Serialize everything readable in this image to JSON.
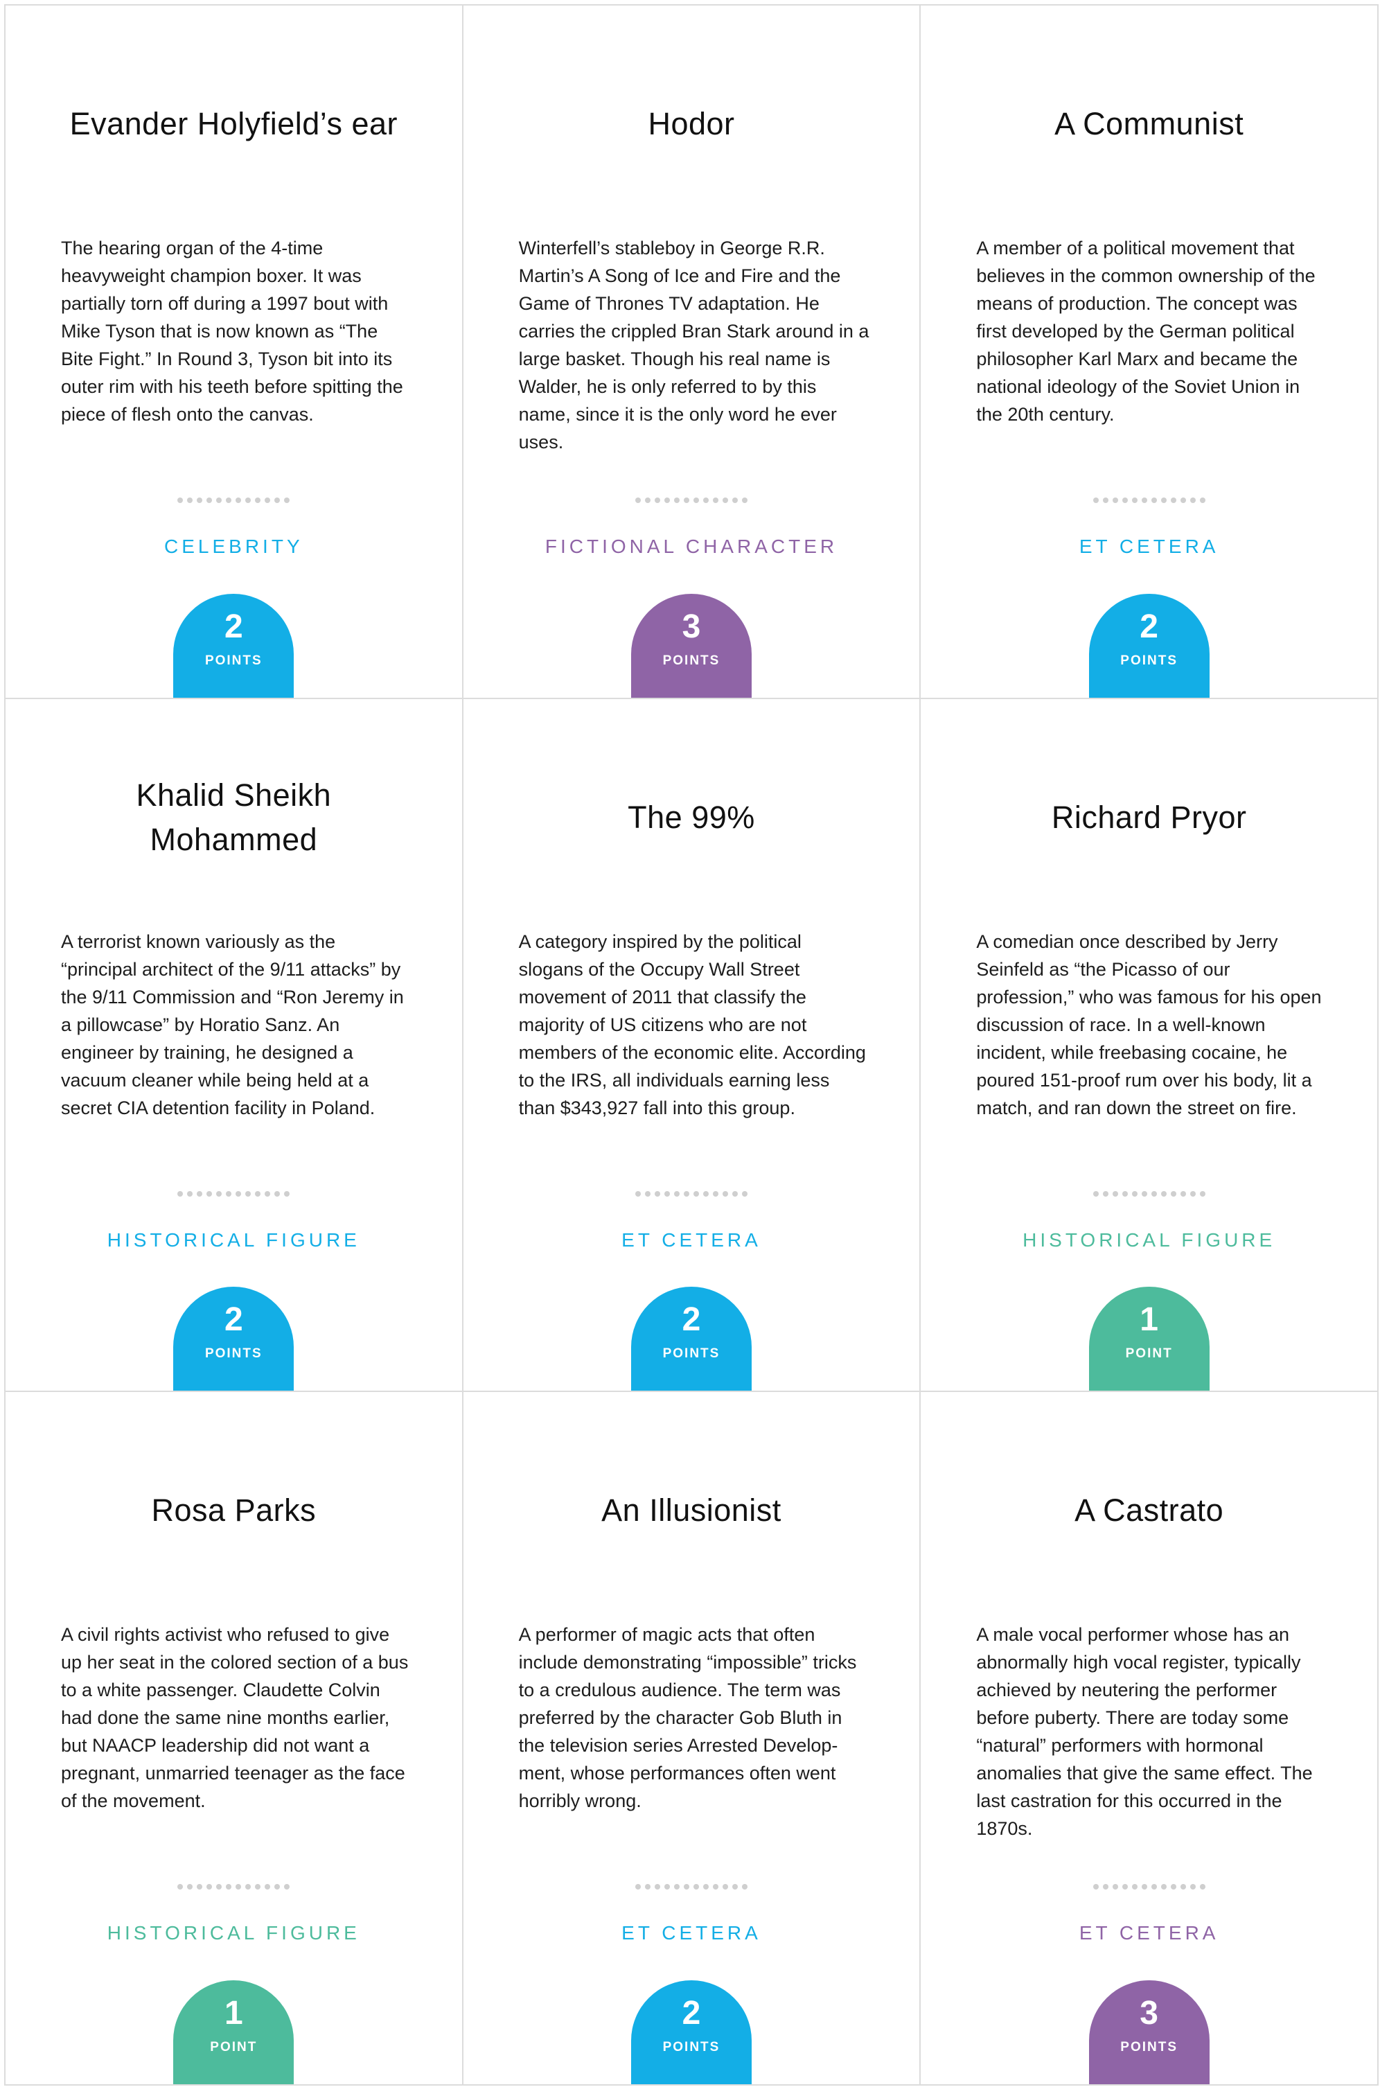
{
  "colors": {
    "celebrity_blue": "#13aee6",
    "fictional_purple": "#8f64a6",
    "historical_green": "#4dbb9c"
  },
  "cards": [
    {
      "title": "Evander Holyfield’s ear",
      "description": "The hearing organ of the 4-time heavyweight champion boxer. It was partially torn off during a 1997 bout with Mike Tyson that is now known as “The Bite Fight.” In Round 3, Tyson bit into its outer rim with his teeth before spitting the piece of flesh onto the canvas.",
      "category": "CELEBRITY",
      "category_color": "#13aee6",
      "points": "2",
      "points_label": "POINTS",
      "badge_color": "#13aee6"
    },
    {
      "title": "Hodor",
      "description": "Winterfell’s stableboy in George R.R. Martin’s A Song of Ice and Fire and the Game of Thrones TV adaptation. He carries the crippled Bran Stark around in a large basket. Though his real name is Walder, he is only referred to by this name, since it is the only word he ever uses.",
      "category": "FICTIONAL CHARACTER",
      "category_color": "#8f64a6",
      "points": "3",
      "points_label": "POINTS",
      "badge_color": "#8f64a6"
    },
    {
      "title": "A Communist",
      "description": "A member of a political movement that believes in the common ownership of the means of production. The concept was first developed by the German political philosopher Karl Marx and became the national ideology of the Soviet Union in the 20th century.",
      "category": "ET CETERA",
      "category_color": "#13aee6",
      "points": "2",
      "points_label": "POINTS",
      "badge_color": "#13aee6"
    },
    {
      "title": "Khalid Sheikh Mohammed",
      "description": "A terrorist known variously as the “principal architect of the 9/11 attacks” by the 9/11 Commission and “Ron Jeremy in a pillowcase” by Horatio Sanz. An engineer by training, he designed a vacuum cleaner while being held at a secret CIA detention facility in Poland.",
      "category": "HISTORICAL FIGURE",
      "category_color": "#13aee6",
      "points": "2",
      "points_label": "POINTS",
      "badge_color": "#13aee6"
    },
    {
      "title": "The 99%",
      "description": "A category inspired by the political slogans of the Occupy Wall Street movement of 2011 that classify the majority of US citizens who are not members of the economic elite. According to the IRS, all individuals earning less than $343,927 fall into this group.",
      "category": "ET CETERA",
      "category_color": "#13aee6",
      "points": "2",
      "points_label": "POINTS",
      "badge_color": "#13aee6"
    },
    {
      "title": "Richard Pryor",
      "description": "A comedian once described by Jerry Seinfeld as “the Picasso of our profession,” who was famous for his open discussion of race. In a well-known incident, while freebasing cocaine, he poured 151-proof rum over his body, lit a match, and ran down the street on fire.",
      "category": "HISTORICAL FIGURE",
      "category_color": "#4dbb9c",
      "points": "1",
      "points_label": "POINT",
      "badge_color": "#4dbb9c"
    },
    {
      "title": "Rosa Parks",
      "description": "A civil rights activist who refused to give up her seat in the colored section of a bus to a white passenger. Claudette Colvin had done the same nine months earlier, but NAACP leadership did not want a pregnant, unmarried teenager as the face of the movement.",
      "category": "HISTORICAL FIGURE",
      "category_color": "#4dbb9c",
      "points": "1",
      "points_label": "POINT",
      "badge_color": "#4dbb9c"
    },
    {
      "title": "An Illusionist",
      "description": "A performer of magic acts that often include demonstrating “impossible” tricks to a credulous audience. The term was preferred by the character Gob Bluth in the television series Arrested Develop-ment, whose performances often went horribly wrong.",
      "category": "ET CETERA",
      "category_color": "#13aee6",
      "points": "2",
      "points_label": "POINTS",
      "badge_color": "#13aee6"
    },
    {
      "title": "A Castrato",
      "description": "A male vocal performer whose has an abnormally high vocal register, typically achieved by neutering the performer before puberty. There are today some “natural” performers with hormonal anomalies that give the same effect. The last castration for this occurred in the 1870s.",
      "category": "ET CETERA",
      "category_color": "#8f64a6",
      "points": "3",
      "points_label": "POINTS",
      "badge_color": "#8f64a6"
    }
  ]
}
